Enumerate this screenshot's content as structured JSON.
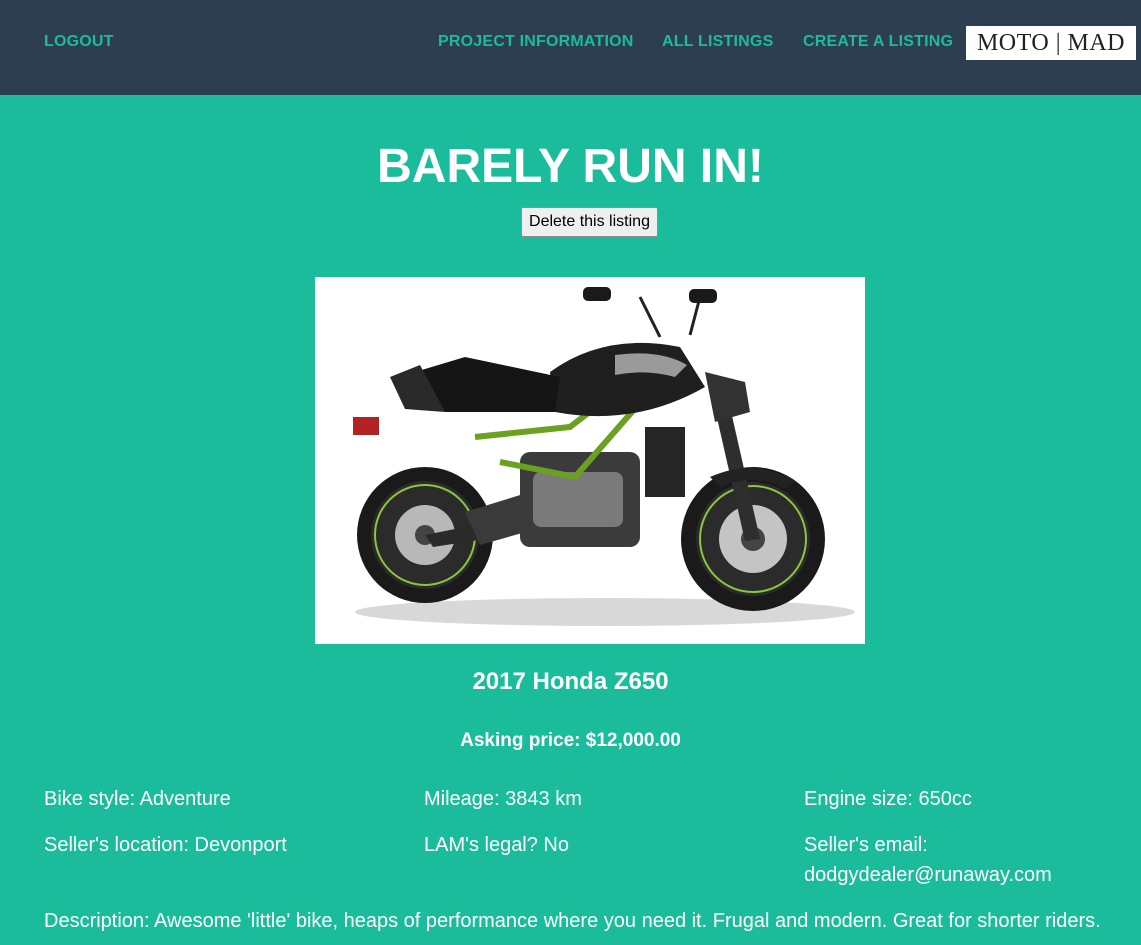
{
  "nav": {
    "logout": "LOGOUT",
    "project_information": "PROJECT INFORMATION",
    "all_listings": "ALL LISTINGS",
    "create_listing": "CREATE A LISTING",
    "logo": "MOTO | MAD"
  },
  "listing": {
    "title": "BARELY RUN IN!",
    "delete_button": "Delete this listing",
    "bike_name": "2017 Honda Z650",
    "price": "Asking price: $12,000.00",
    "bike_style": "Bike style: Adventure",
    "mileage": "Mileage: 3843 km",
    "engine_size": "Engine size: 650cc",
    "location": "Seller's location: Devonport",
    "lams": "LAM's legal? No",
    "email_label": "Seller's email:",
    "email": "dodgydealer@runaway.com",
    "description": "Description: Awesome 'little' bike, heaps of performance where you need it. Frugal and modern. Great for shorter riders."
  },
  "colors": {
    "page_background": "#1abc9c",
    "navbar_background": "#2c3e50",
    "nav_link": "#1abc9c",
    "text": "#ffffff"
  }
}
